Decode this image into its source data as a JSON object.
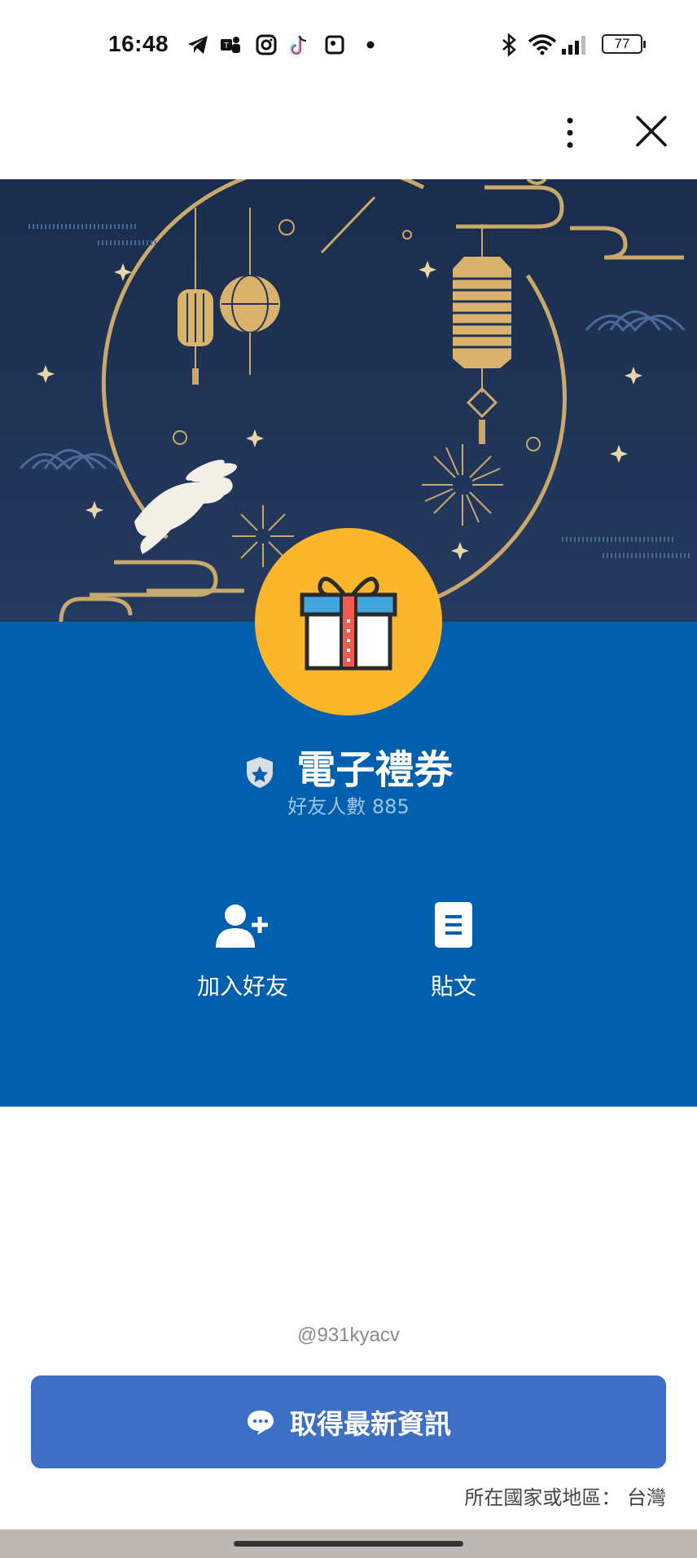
{
  "status_bar": {
    "time": "16:48",
    "battery": "77",
    "icons": [
      "telegram-icon",
      "teams-icon",
      "instagram-icon",
      "tiktok-icon",
      "app-icon",
      "dot-icon",
      "bluetooth-icon",
      "wifi-icon",
      "signal-icon",
      "battery-icon"
    ]
  },
  "top_bar": {
    "menu_icon": "more-vert-icon",
    "close_icon": "close-icon"
  },
  "profile": {
    "name": "電子禮券",
    "friends_count": "好友人數 885",
    "avatar_icon": "gift-icon",
    "badge_icon": "shield-star-icon"
  },
  "actions": [
    {
      "label": "加入好友",
      "icon": "add-friend-icon"
    },
    {
      "label": "貼文",
      "icon": "post-icon"
    }
  ],
  "handle": "@931kyacv",
  "cta": {
    "label": "取得最新資訊",
    "icon": "chat-bubble-icon"
  },
  "region": "所在國家或地區： 台灣",
  "colors": {
    "hero_bg": "#1f3457",
    "panel_blue": "#0060ad",
    "avatar_bg": "#fbb62b",
    "cta_blue": "#3d70c4",
    "gold": "#c9a96b"
  }
}
